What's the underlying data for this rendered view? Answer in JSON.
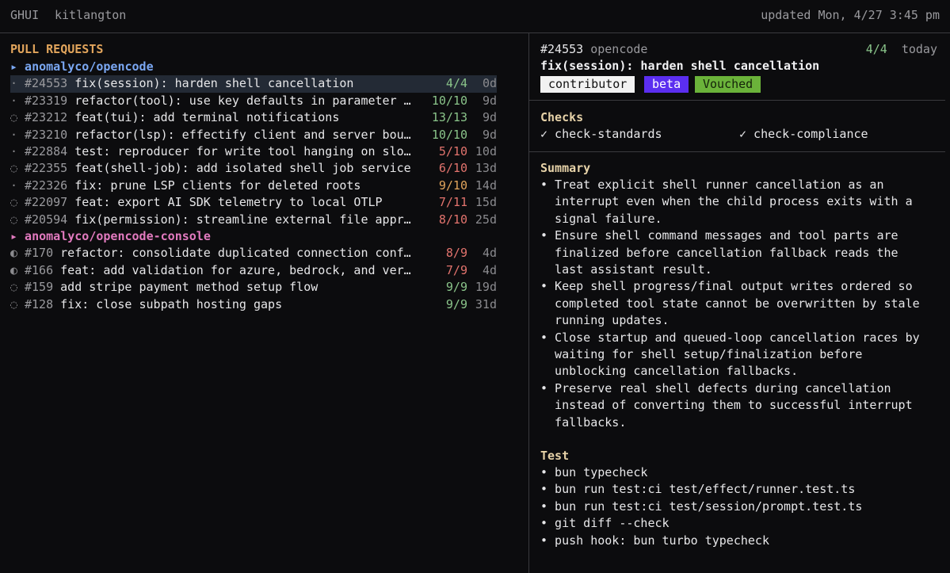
{
  "header": {
    "app_name": "GHUI",
    "user": "kitlangton",
    "updated": "updated Mon, 4/27 3:45 pm"
  },
  "left": {
    "heading": "PULL REQUESTS",
    "repos": [
      {
        "name": "▸ anomalyco/opencode",
        "prs": [
          {
            "marker": "·",
            "number": "#24553",
            "title": "fix(session): harden shell cancellation",
            "checks": "4/4",
            "status": "g",
            "age": "0d"
          },
          {
            "marker": "·",
            "number": "#23319",
            "title": "refactor(tool): use key defaults in parameter …",
            "checks": "10/10",
            "status": "g",
            "age": "9d"
          },
          {
            "marker": "◌",
            "number": "#23212",
            "title": "feat(tui): add terminal notifications",
            "checks": "13/13",
            "status": "g",
            "age": "9d"
          },
          {
            "marker": "·",
            "number": "#23210",
            "title": "refactor(lsp): effectify client and server bou…",
            "checks": "10/10",
            "status": "g",
            "age": "9d"
          },
          {
            "marker": "·",
            "number": "#22884",
            "title": "test: reproducer for write tool hanging on slo…",
            "checks": "5/10",
            "status": "r",
            "age": "10d"
          },
          {
            "marker": "◌",
            "number": "#22355",
            "title": "feat(shell-job): add isolated shell job service",
            "checks": "6/10",
            "status": "r",
            "age": "13d"
          },
          {
            "marker": "·",
            "number": "#22326",
            "title": "fix: prune LSP clients for deleted roots",
            "checks": "9/10",
            "status": "o",
            "age": "14d"
          },
          {
            "marker": "◌",
            "number": "#22097",
            "title": "feat: export AI SDK telemetry to local OTLP",
            "checks": "7/11",
            "status": "r",
            "age": "15d"
          },
          {
            "marker": "◌",
            "number": "#20594",
            "title": "fix(permission): streamline external file appr…",
            "checks": "8/10",
            "status": "r",
            "age": "25d"
          }
        ]
      },
      {
        "name": "▸ anomalyco/opencode-console",
        "prs": [
          {
            "marker": "◐",
            "number": "#170",
            "title": "refactor: consolidate duplicated connection conf…",
            "checks": "8/9",
            "status": "r",
            "age": "4d"
          },
          {
            "marker": "◐",
            "number": "#166",
            "title": "feat: add validation for azure, bedrock, and ver…",
            "checks": "7/9",
            "status": "r",
            "age": "4d"
          },
          {
            "marker": "◌",
            "number": "#159",
            "title": "add stripe payment method setup flow",
            "checks": "9/9",
            "status": "g",
            "age": "19d"
          },
          {
            "marker": "◌",
            "number": "#128",
            "title": "fix: close subpath hosting gaps",
            "checks": "9/9",
            "status": "g",
            "age": "31d"
          }
        ]
      }
    ]
  },
  "detail": {
    "number": "#24553",
    "repo": "opencode",
    "checks": "4/4",
    "age": "today",
    "title": "fix(session): harden shell cancellation",
    "badges": [
      "contributor",
      "beta",
      "Vouched"
    ],
    "checks_title": "Checks",
    "check_items": [
      "✓ check-standards",
      "✓ check-compliance"
    ],
    "summary_title": "Summary",
    "summary_lines": [
      "• Treat explicit shell runner cancellation as an",
      "  interrupt even when the child process exits with a",
      "  signal failure.",
      "• Ensure shell command messages and tool parts are",
      "  finalized before cancellation fallback reads the",
      "  last assistant result.",
      "• Keep shell progress/final output writes ordered so",
      "  completed tool state cannot be overwritten by stale",
      "  running updates.",
      "• Close startup and queued-loop cancellation races by",
      "  waiting for shell setup/finalization before",
      "  unblocking cancellation fallbacks.",
      "• Preserve real shell defects during cancellation",
      "  instead of converting them to successful interrupt",
      "  fallbacks."
    ],
    "test_title": "Test",
    "test_lines": [
      "• bun typecheck",
      "• bun run test:ci test/effect/runner.test.ts",
      "• bun run test:ci test/session/prompt.test.ts",
      "• git diff --check",
      "• push hook: bun turbo typecheck"
    ]
  }
}
